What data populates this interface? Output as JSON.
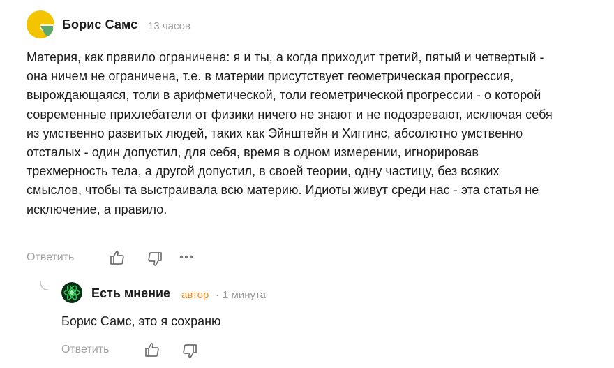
{
  "comment": {
    "author": "Борис Самс",
    "time": "13 часов",
    "text": "Материя, как правило ограничена: я и ты, а когда приходит третий, пятый и четвертый - она ничем не ограничена, т.е. в материи присутствует геометрическая прогрессия, вырождающаяся, толи в арифметической, толи геометрической прогрессии - о которой современные прихлебатели от физики ничего не знают и не подозревают, исключая себя из умственно развитых людей, таких как Эйнштейн и Хиггинс, абсолютно умственно отсталых - один допустил, для себя, время в одном измерении, игнорировав трехмерность тела, а другой допустил, в своей теории, одну частицу, без всяких смыслов, чтобы та выстраивала всю материю. Идиоты живут среди нас - эта статья не исключение, а правило.",
    "actions": {
      "reply_label": "Ответить"
    },
    "avatar_colors": [
      "#f5c400",
      "#5fa86b",
      "#f3f3f3"
    ]
  },
  "reply": {
    "author": "Есть мнение",
    "role": "автор",
    "separator": "·",
    "time": "1 минута",
    "text": "Борис Самс, это я сохраню",
    "actions": {
      "reply_label": "Ответить"
    },
    "avatar_colors": [
      "#0b2e17",
      "#2fd05a"
    ]
  },
  "colors": {
    "author_badge": "#f08c1a",
    "muted": "#9a9a9a"
  },
  "icons": [
    "like-icon",
    "dislike-icon",
    "more-icon",
    "thread-line-icon"
  ]
}
